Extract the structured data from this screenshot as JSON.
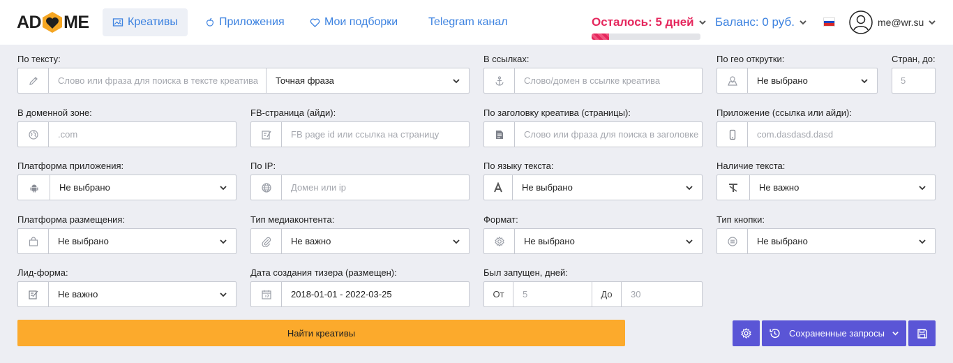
{
  "header": {
    "logo_left": "AD",
    "logo_right": "ME",
    "nav": [
      {
        "label": "Креативы",
        "icon": "image-icon"
      },
      {
        "label": "Приложения",
        "icon": "apple-icon"
      },
      {
        "label": "Мои подборки",
        "icon": "heart-icon"
      },
      {
        "label": "Telegram канал"
      }
    ],
    "subscription_days": "Осталось: 5 дней",
    "subscription_progress": 0.16,
    "balance": "Баланс: 0 руб.",
    "language_flag": "ru-flag-icon",
    "user_email": "me@wr.su"
  },
  "form": {
    "text": {
      "label": "По тексту:",
      "placeholder": "Слово или фраза для поиска в тексте креатива",
      "mode": "Точная фраза"
    },
    "links": {
      "label": "В ссылках:",
      "placeholder": "Слово/домен в ссылке креатива"
    },
    "geo": {
      "label": "По гео открутки:",
      "value": "Не выбрано"
    },
    "countries": {
      "label": "Стран, до:",
      "placeholder": "5"
    },
    "domain_zone": {
      "label": "В доменной зоне:",
      "placeholder": ".com"
    },
    "fb_page": {
      "label": "FB-страница (айди):",
      "placeholder": "FB page id или ссылка на страницу"
    },
    "headline": {
      "label": "По заголовку креатива (страницы):",
      "placeholder": "Слово или фраза для поиска в заголовке"
    },
    "app": {
      "label": "Приложение (ссылка или айди):",
      "placeholder": "com.dasdasd.dasd"
    },
    "app_platform": {
      "label": "Платформа приложения:",
      "value": "Не выбрано"
    },
    "ip": {
      "label": "По IP:",
      "placeholder": "Домен или  ip"
    },
    "language": {
      "label": "По языку текста:",
      "value": "Не выбрано"
    },
    "has_text": {
      "label": "Наличие текста:",
      "value": "Не важно"
    },
    "placement": {
      "label": "Платформа размещения:",
      "value": "Не выбрано"
    },
    "media_type": {
      "label": "Тип медиаконтента:",
      "value": "Не важно"
    },
    "format": {
      "label": "Формат:",
      "value": "Не выбрано"
    },
    "button_type": {
      "label": "Тип кнопки:",
      "value": "Не выбрано"
    },
    "lead_form": {
      "label": "Лид-форма:",
      "value": "Не важно"
    },
    "created_date": {
      "label": "Дата создания тизера (размещен):",
      "value": "2018-01-01 - 2022-03-25"
    },
    "days_running": {
      "label": "Был запущен, дней:",
      "from_label": "От",
      "from_placeholder": "5",
      "to_label": "До",
      "to_placeholder": "30"
    }
  },
  "actions": {
    "search": "Найти креативы",
    "saved_queries": "Сохраненные запросы"
  },
  "colors": {
    "accent": "#3c82e0",
    "warning": "#e5275d",
    "search_button": "#fcaa2c",
    "action_buttons": "#5a55d6"
  }
}
